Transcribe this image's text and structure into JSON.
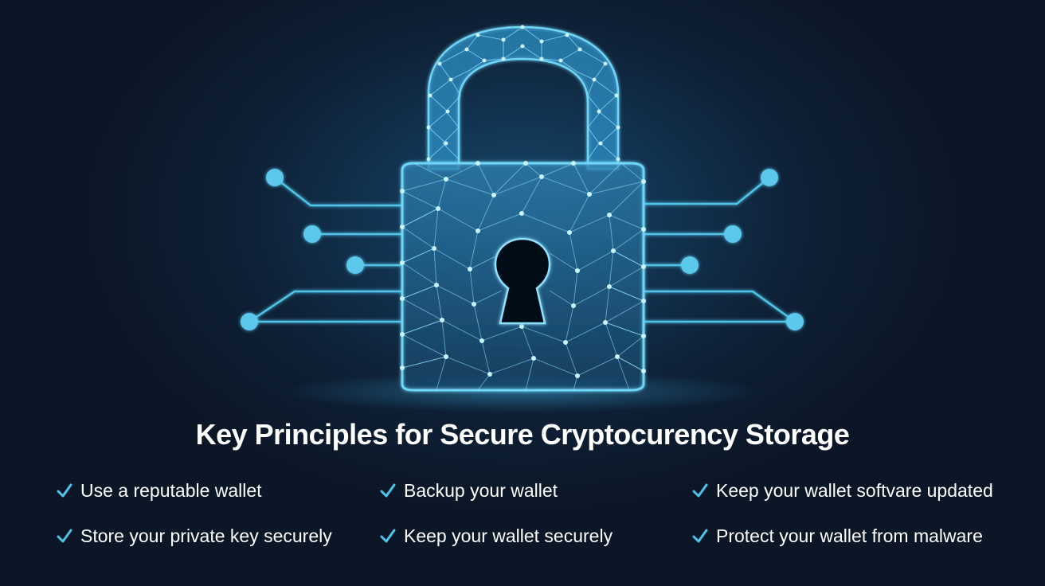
{
  "title": "Key Principles for Secure Cryptocurency Storage",
  "principles": [
    {
      "label": "Use a reputable wallet"
    },
    {
      "label": "Backup your wallet"
    },
    {
      "label": "Keep your wallet softvare updated"
    },
    {
      "label": "Store your private key securely"
    },
    {
      "label": "Keep your wallet securely"
    },
    {
      "label": "Protect your wallet from malware"
    }
  ],
  "icons": {
    "lock": "padlock-icon",
    "keyhole": "keyhole-icon",
    "check": "checkmark-icon"
  },
  "colors": {
    "background": "#0d1a2b",
    "accent": "#4fc3e8",
    "text": "#ffffff"
  }
}
